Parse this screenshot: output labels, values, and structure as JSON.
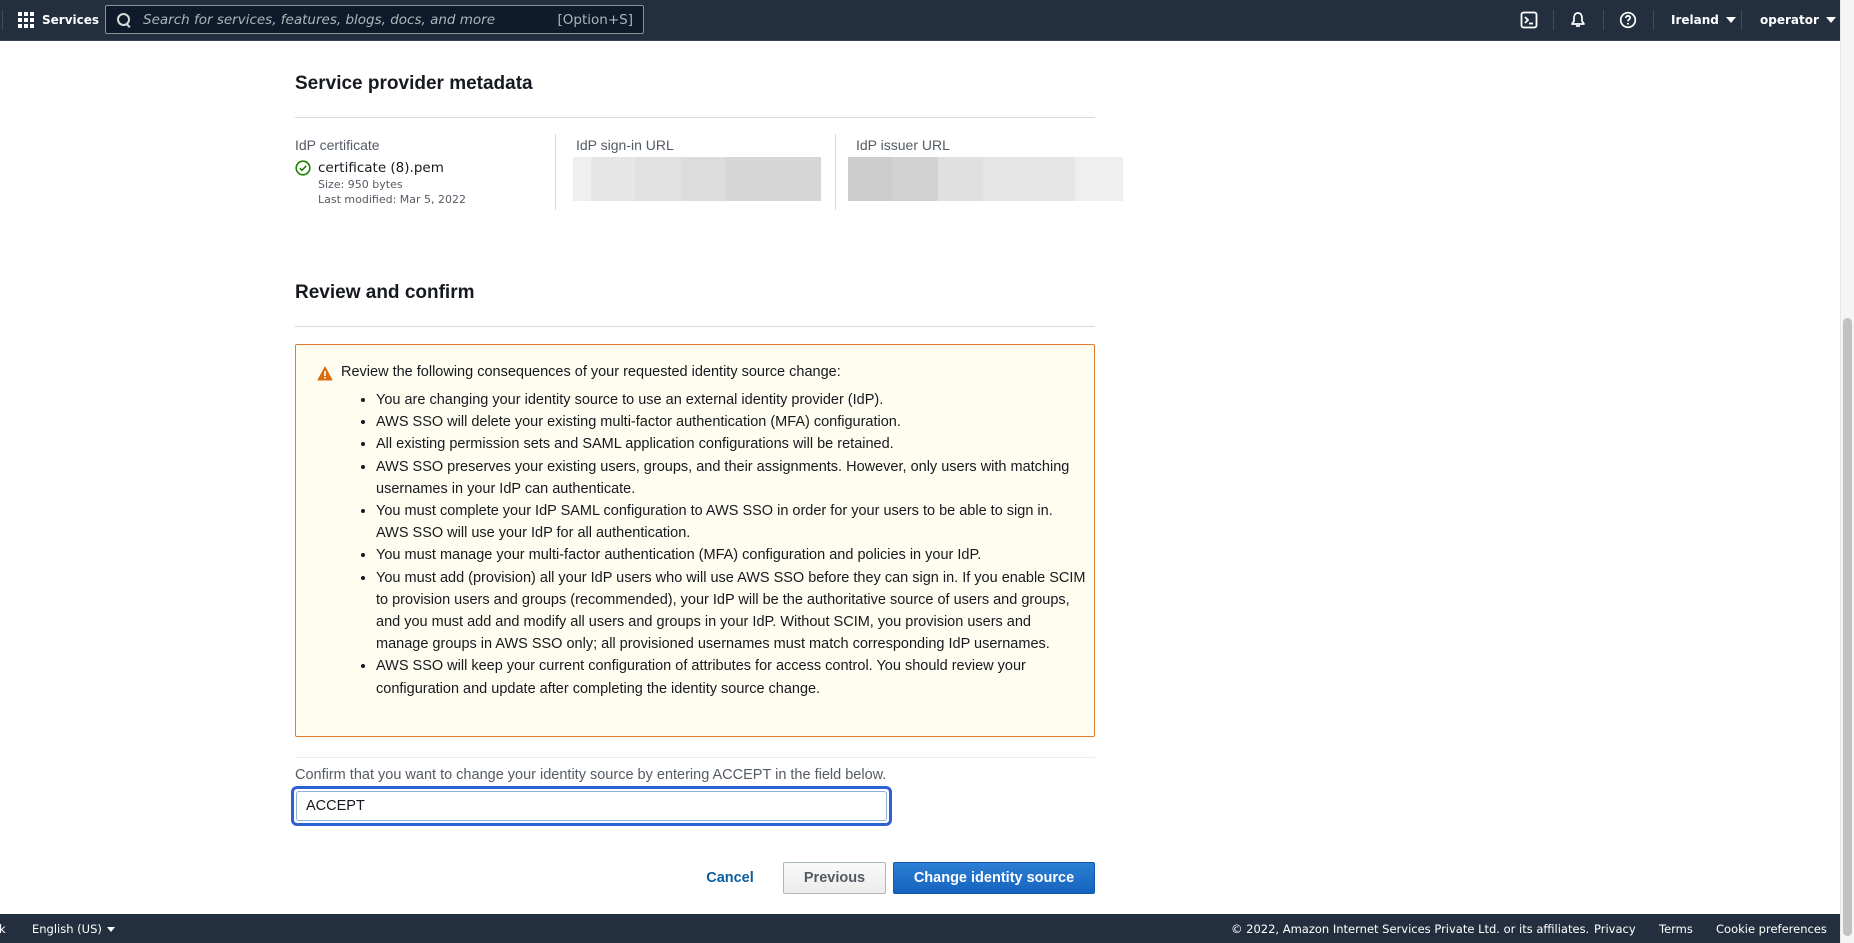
{
  "topnav": {
    "services_label": "Services",
    "search_placeholder": "Search for services, features, blogs, docs, and more",
    "search_shortcut": "[Option+S]",
    "icons": [
      "cloudshell-icon",
      "notifications-bell-icon",
      "help-icon"
    ],
    "region_label": "Ireland",
    "account_label": "operator"
  },
  "metadata_section": {
    "title": "Service provider metadata",
    "certificate": {
      "label": "IdP certificate",
      "status_icon": "success-check-icon",
      "file_name": "certificate (8).pem",
      "size": "Size: 950 bytes",
      "last_modified": "Last modified: Mar 5, 2022"
    },
    "sign_in_url": {
      "label": "IdP sign-in URL",
      "value_redacted": true
    },
    "issuer_url": {
      "label": "IdP issuer URL",
      "value_redacted": true
    }
  },
  "review_section": {
    "title": "Review and confirm",
    "warning": {
      "icon": "warning-triangle-icon",
      "title": "Review the following consequences of your requested identity source change:",
      "items": [
        "You are changing your identity source to use an external identity provider (IdP).",
        "AWS SSO will delete your existing multi-factor authentication (MFA) configuration.",
        "All existing permission sets and SAML application configurations will be retained.",
        "AWS SSO preserves your existing users, groups, and their assignments. However, only users with matching usernames in your IdP can authenticate.",
        "You must complete your IdP SAML configuration to AWS SSO in order for your users to be able to sign in. AWS SSO will use your IdP for all authentication.",
        "You must manage your multi-factor authentication (MFA) configuration and policies in your IdP.",
        "You must add (provision) all your IdP users who will use AWS SSO before they can sign in. If you enable SCIM to provision users and groups (recommended), your IdP will be the authoritative source of users and groups, and you must add and modify all users and groups in your IdP. Without SCIM, you provision users and manage groups in AWS SSO only; all provisioned usernames must match corresponding IdP usernames.",
        "AWS SSO will keep your current configuration of attributes for access control. You should review your configuration and update after completing the identity source change."
      ]
    },
    "confirm_label": "Confirm that you want to change your identity source by entering ACCEPT in the field below.",
    "confirm_value": "ACCEPT"
  },
  "actions": {
    "cancel_label": "Cancel",
    "previous_label": "Previous",
    "submit_label": "Change identity source"
  },
  "footer": {
    "feedback_partial": "k",
    "language_label": "English (US)",
    "copyright": "© 2022, Amazon Internet Services Private Ltd. or its affiliates.",
    "links": [
      "Privacy",
      "Terms",
      "Cookie preferences"
    ]
  },
  "colors": {
    "nav_bg": "#232f3e",
    "primary_button": "#1a6bc6",
    "link": "#0a5d9e",
    "warning_border": "#e07c2e",
    "warning_bg": "#fffdf0",
    "success": "#1d8102",
    "focus_ring": "#2e61d3"
  }
}
